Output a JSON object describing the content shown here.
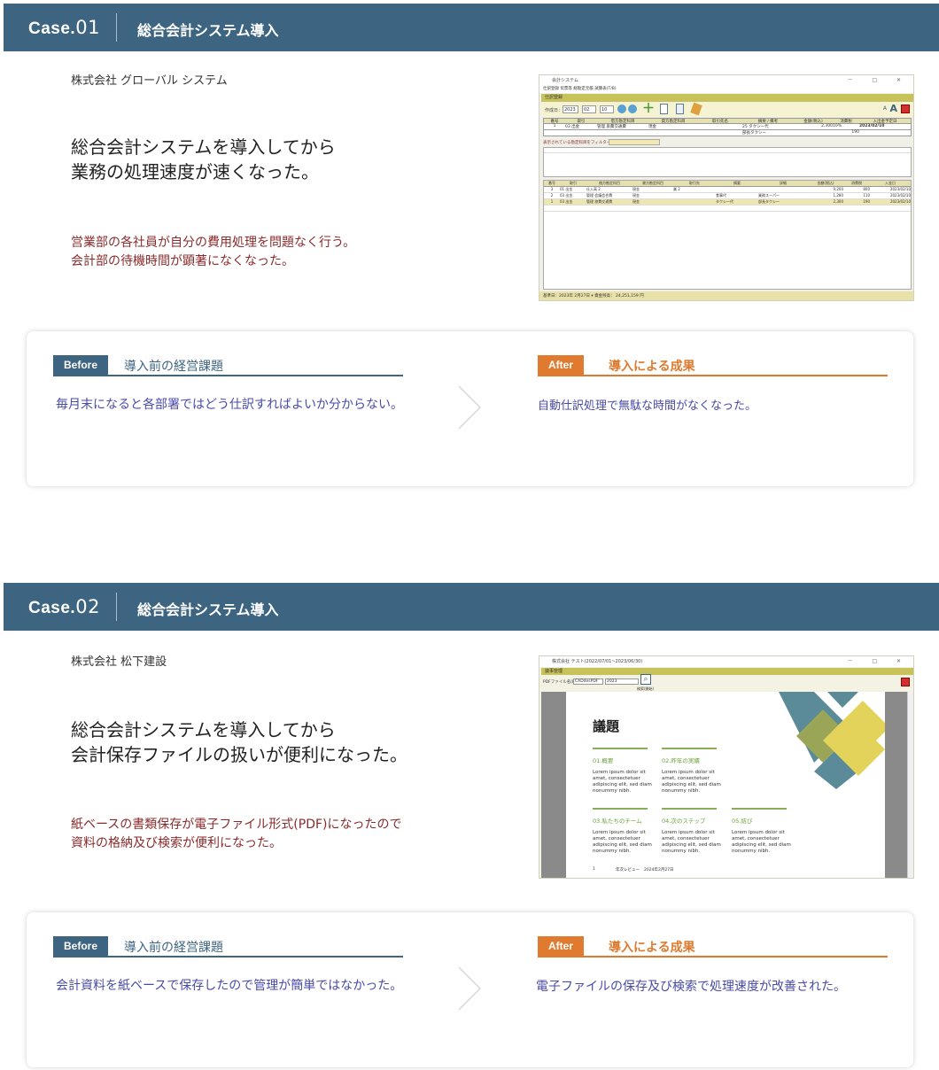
{
  "cases": [
    {
      "label": "Case.",
      "number": "01",
      "title": "総合会計システム導入",
      "company": "株式会社 グローバル システム",
      "headline_lines": [
        "総合会計システムを導入してから",
        "業務の処理速度が速くなった。"
      ],
      "desc_lines": [
        "営業部の各社員が自分の費用処理を問題なく行う。",
        "会計部の待機時間が顕著になくなった。"
      ],
      "before_tag": "Before",
      "before_title": "導入前の経営課題",
      "before_text": "毎月末になると各部署ではどう仕訳すればよいか分からない。",
      "after_tag": "After",
      "after_title": "導入による成果",
      "after_text": "自動仕訳処理で無駄な時間がなくなった。",
      "screenshot": {
        "window_title": "会計システム",
        "menu": "仕訳登録 伝票等 総勘定元帳 試算表(T/B)",
        "panel": "仕訳登録",
        "date_label": "作成日：",
        "date_year": "2023",
        "date_month": "02",
        "date_day": "10",
        "headers": [
          "番号",
          "取引",
          "借方勘定科目",
          "貸方勘定科目",
          "取引先名",
          "摘要 / 備考",
          "金額(税込)",
          "消費税",
          "入出金予定日"
        ],
        "entry": [
          "1",
          "03 出金",
          "管理 旅費交通費",
          "現金",
          "",
          "25 タクシー代",
          "2,300",
          "10%",
          "2023/02/10"
        ],
        "entry2": [
          "",
          "",
          "",
          "",
          "",
          "部長タクシー",
          "",
          "190",
          ""
        ],
        "filter_label": "表示されている勘定科目をフィルター",
        "list_headers": [
          "番号",
          "取引",
          "借方勘定科目",
          "貸方勘定科目",
          "取引先",
          "摘要",
          "詳細",
          "金額(税込)",
          "消費税",
          "入金日"
        ],
        "rows": [
          [
            "3",
            "01 出金",
            "仕入高 2",
            "現金",
            "業 2",
            "",
            "",
            "9,200",
            "800",
            "2023/02/10"
          ],
          [
            "2",
            "03 出金",
            "管理 会議会合費",
            "現金",
            "",
            "食事代",
            "業務スーパー",
            "1,280",
            "110",
            "2023/02/10"
          ],
          [
            "1",
            "03 出金",
            "管理 旅費交通費",
            "現金",
            "",
            "タクシー代",
            "部長タクシー",
            "2,300",
            "190",
            "2023/02/10"
          ]
        ],
        "status": "基準日：2023年 2月27日 ▾   資金残高：  24,251,159 円"
      }
    },
    {
      "label": "Case.",
      "number": "02",
      "title": "総合会計システム導入",
      "company": "株式会社 松下建設",
      "headline_lines": [
        "総合会計システムを導入してから",
        "会計保存ファイルの扱いが便利になった。"
      ],
      "desc_lines": [
        "紙ベースの書類保存が電子ファイル形式(PDF)になったので",
        "資料の格納及び検索が便利になった。"
      ],
      "before_tag": "Before",
      "before_title": "導入前の経営課題",
      "before_text": "会計資料を紙ベースで保存したので管理が簡単ではなかった。",
      "after_tag": "After",
      "after_title": "導入による成果",
      "after_text": "電子ファイルの保存及び検索で処理速度が改善された。",
      "screenshot": {
        "window_title": "株式会社 テスト(2022/07/01~2023/06/30)",
        "panel": "議事管理",
        "pdf_label": "PDFファイル名(R):",
        "pdf_value": "CADdesPDF",
        "pdf_year": "2023",
        "search_label": "検索(開始)",
        "doc_title": "議題",
        "sections": [
          {
            "title": "01.概要",
            "body": "Lorem ipsum dolor sit amet, consectetuer adipiscing elit, sed diam nonummy nibh."
          },
          {
            "title": "02.昨年の実績",
            "body": "Lorem ipsum dolor sit amet, consectetuer adipiscing elit, sed diam nonummy nibh."
          },
          {
            "title": "03.私たちのチーム",
            "body": "Lorem ipsum dolor sit amet, consectetuer adipiscing elit, sed diam nonummy nibh."
          },
          {
            "title": "04.次のステップ",
            "body": "Lorem ipsum dolor sit amet, consectetuer adipiscing elit, sed diam nonummy nibh."
          },
          {
            "title": "05.結び",
            "body": "Lorem ipsum dolor sit amet, consectetuer adipiscing elit, sed diam nonummy nibh."
          }
        ],
        "footer_page": "1",
        "footer_text": "年次レビュー",
        "footer_date": "2024年2月27日"
      }
    }
  ]
}
